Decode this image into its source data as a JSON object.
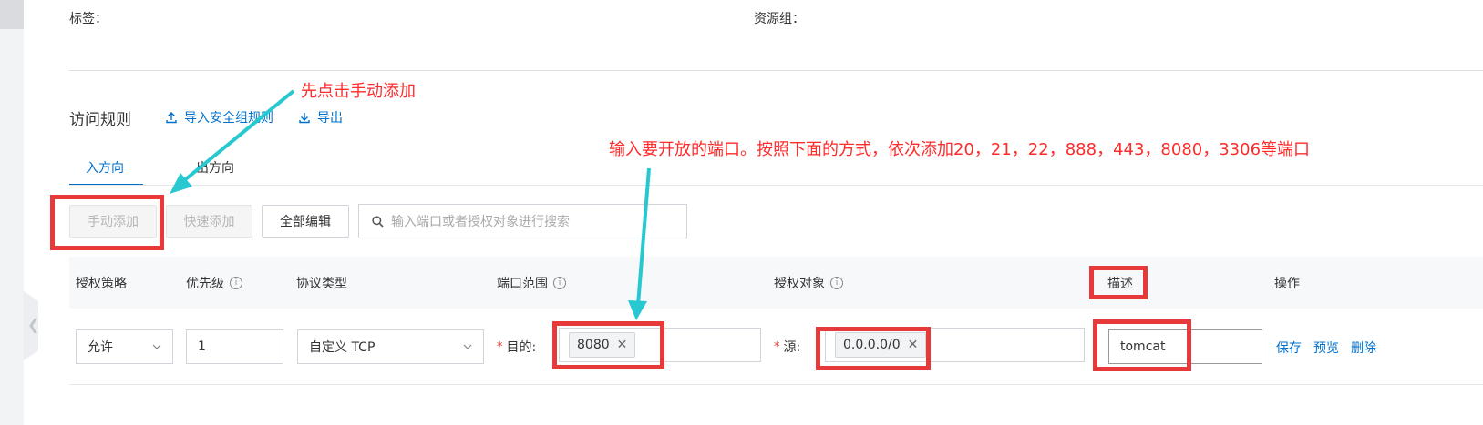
{
  "meta": {
    "tags_label": "标签：",
    "resource_group_label": "资源组："
  },
  "section": {
    "title": "访问规则",
    "import_link": "导入安全组规则",
    "export_link": "导出"
  },
  "tabs": [
    {
      "label": "入方向",
      "active": true
    },
    {
      "label": "出方向",
      "active": false
    }
  ],
  "toolbar": {
    "manual_add": "手动添加",
    "quick_add": "快速添加",
    "edit_all": "全部编辑",
    "search_placeholder": "输入端口或者授权对象进行搜索"
  },
  "table": {
    "headers": [
      "授权策略",
      "优先级",
      "协议类型",
      "端口范围",
      "授权对象",
      "描述",
      "操作"
    ],
    "row": {
      "policy": "允许",
      "priority": "1",
      "protocol": "自定义 TCP",
      "port_label": "目的:",
      "port_tag": "8080",
      "source_label": "源:",
      "source_tag": "0.0.0.0/0",
      "description": "tomcat",
      "actions": [
        "保存",
        "预览",
        "删除"
      ]
    }
  },
  "annotations": {
    "first": "先点击手动添加",
    "second": "输入要开放的端口。按照下面的方式，依次添加20，21，22，888，443，8080，3306等端口"
  },
  "colors": {
    "accent": "#0070cc",
    "annotation_red": "#ff2a2a",
    "highlight_box": "#e8393a",
    "arrow": "#27c8d0"
  }
}
